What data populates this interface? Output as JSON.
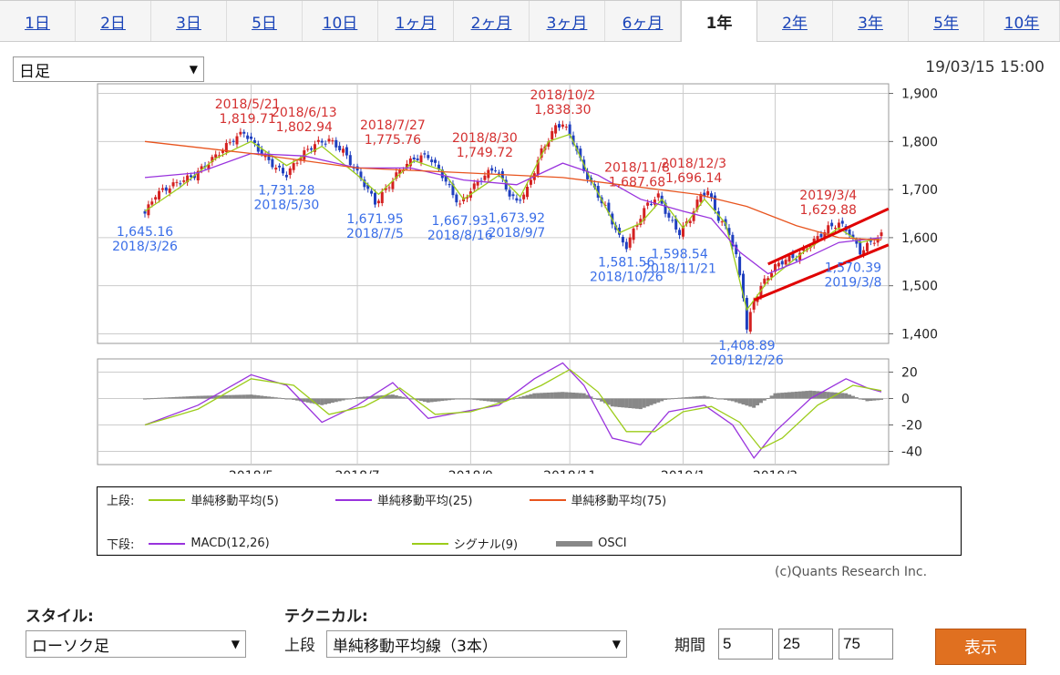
{
  "tabs": [
    "1日",
    "2日",
    "3日",
    "5日",
    "10日",
    "1ヶ月",
    "2ヶ月",
    "3ヶ月",
    "6ヶ月",
    "1年",
    "2年",
    "3年",
    "5年",
    "10年"
  ],
  "active_tab": "1年",
  "period_select": "日足",
  "timestamp": "19/03/15 15:00",
  "colors": {
    "up_candle": "#d42020",
    "down_candle": "#1f3fbf",
    "ma5": "#9ccc1a",
    "ma25": "#9933dd",
    "ma75": "#e8541e",
    "annot_red": "#d43030",
    "annot_blue": "#3a6ee8",
    "osci": "#888888",
    "trendline": "#e00000",
    "button": "#e07020"
  },
  "chart_data": [
    {
      "type": "line",
      "panel": "upper",
      "ylim": [
        1380,
        1920
      ],
      "y_ticks": [
        "1,900",
        "1,800",
        "1,700",
        "1,600",
        "1,500",
        "1,400"
      ],
      "y_tick_values": [
        1900,
        1800,
        1700,
        1600,
        1500,
        1400
      ],
      "x_ticks": [
        "2018/5",
        "2018/7",
        "2018/9",
        "2018/11",
        "2019/1",
        "2019/3"
      ],
      "x_tick_index": [
        30,
        60,
        92,
        120,
        152,
        178
      ],
      "n_days": 184,
      "close_path": [
        [
          0,
          1650
        ],
        [
          3,
          1690
        ],
        [
          8,
          1710
        ],
        [
          14,
          1730
        ],
        [
          20,
          1770
        ],
        [
          25,
          1805
        ],
        [
          28,
          1819
        ],
        [
          33,
          1775
        ],
        [
          37,
          1745
        ],
        [
          40,
          1731
        ],
        [
          44,
          1770
        ],
        [
          48,
          1795
        ],
        [
          52,
          1803
        ],
        [
          56,
          1780
        ],
        [
          59,
          1745
        ],
        [
          63,
          1700
        ],
        [
          65,
          1672
        ],
        [
          68,
          1700
        ],
        [
          72,
          1740
        ],
        [
          76,
          1765
        ],
        [
          80,
          1770
        ],
        [
          84,
          1730
        ],
        [
          87,
          1690
        ],
        [
          89,
          1668
        ],
        [
          92,
          1700
        ],
        [
          96,
          1730
        ],
        [
          99,
          1745
        ],
        [
          103,
          1690
        ],
        [
          105,
          1674
        ],
        [
          108,
          1700
        ],
        [
          112,
          1780
        ],
        [
          116,
          1830
        ],
        [
          118,
          1838
        ],
        [
          121,
          1800
        ],
        [
          124,
          1740
        ],
        [
          127,
          1700
        ],
        [
          131,
          1650
        ],
        [
          134,
          1600
        ],
        [
          136,
          1582
        ],
        [
          139,
          1630
        ],
        [
          142,
          1670
        ],
        [
          145,
          1686
        ],
        [
          148,
          1640
        ],
        [
          151,
          1610
        ],
        [
          154,
          1640
        ],
        [
          157,
          1690
        ],
        [
          159,
          1696
        ],
        [
          162,
          1640
        ],
        [
          165,
          1610
        ],
        [
          167,
          1560
        ],
        [
          169,
          1480
        ],
        [
          170,
          1409
        ],
        [
          172,
          1470
        ],
        [
          175,
          1510
        ],
        [
          178,
          1540
        ],
        [
          181,
          1555
        ],
        [
          184,
          1560
        ],
        [
          187,
          1580
        ],
        [
          190,
          1600
        ],
        [
          193,
          1620
        ],
        [
          196,
          1630
        ],
        [
          199,
          1610
        ],
        [
          202,
          1570
        ],
        [
          205,
          1590
        ],
        [
          208,
          1605
        ]
      ],
      "moving_averages": [
        {
          "name": "単純移動平均(5)",
          "points": [
            [
              0,
              1655
            ],
            [
              10,
              1705
            ],
            [
              20,
              1765
            ],
            [
              30,
              1800
            ],
            [
              40,
              1750
            ],
            [
              50,
              1790
            ],
            [
              60,
              1730
            ],
            [
              66,
              1690
            ],
            [
              76,
              1760
            ],
            [
              84,
              1740
            ],
            [
              90,
              1680
            ],
            [
              100,
              1730
            ],
            [
              106,
              1685
            ],
            [
              114,
              1800
            ],
            [
              120,
              1815
            ],
            [
              126,
              1720
            ],
            [
              134,
              1610
            ],
            [
              140,
              1630
            ],
            [
              146,
              1680
            ],
            [
              152,
              1620
            ],
            [
              158,
              1680
            ],
            [
              164,
              1630
            ],
            [
              170,
              1450
            ],
            [
              176,
              1510
            ],
            [
              186,
              1570
            ],
            [
              196,
              1620
            ],
            [
              202,
              1590
            ],
            [
              208,
              1600
            ]
          ]
        },
        {
          "name": "単純移動平均(25)",
          "points": [
            [
              0,
              1725
            ],
            [
              15,
              1735
            ],
            [
              30,
              1775
            ],
            [
              45,
              1770
            ],
            [
              60,
              1745
            ],
            [
              75,
              1745
            ],
            [
              90,
              1720
            ],
            [
              105,
              1710
            ],
            [
              118,
              1755
            ],
            [
              128,
              1730
            ],
            [
              140,
              1680
            ],
            [
              152,
              1655
            ],
            [
              160,
              1640
            ],
            [
              168,
              1570
            ],
            [
              176,
              1525
            ],
            [
              186,
              1555
            ],
            [
              196,
              1590
            ],
            [
              208,
              1600
            ]
          ]
        },
        {
          "name": "単純移動平均(75)",
          "points": [
            [
              0,
              1800
            ],
            [
              30,
              1775
            ],
            [
              60,
              1745
            ],
            [
              90,
              1735
            ],
            [
              118,
              1725
            ],
            [
              140,
              1705
            ],
            [
              156,
              1690
            ],
            [
              170,
              1665
            ],
            [
              184,
              1625
            ],
            [
              196,
              1600
            ],
            [
              208,
              1595
            ]
          ]
        }
      ],
      "annotations": [
        {
          "date": "2018/5/21",
          "value": "1,819.71",
          "kind": "high"
        },
        {
          "date": "2018/6/13",
          "value": "1,802.94",
          "kind": "high"
        },
        {
          "date": "2018/7/27",
          "value": "1,775.76",
          "kind": "high"
        },
        {
          "date": "2018/8/30",
          "value": "1,749.72",
          "kind": "high"
        },
        {
          "date": "2018/10/2",
          "value": "1,838.30",
          "kind": "high"
        },
        {
          "date": "2018/11/8",
          "value": "1,687.68",
          "kind": "high"
        },
        {
          "date": "2018/12/3",
          "value": "1,696.14",
          "kind": "high"
        },
        {
          "date": "2019/3/4",
          "value": "1,629.88",
          "kind": "high"
        },
        {
          "date": "2018/3/26",
          "value": "1,645.16",
          "kind": "low"
        },
        {
          "date": "2018/5/30",
          "value": "1,731.28",
          "kind": "low"
        },
        {
          "date": "2018/7/5",
          "value": "1,671.95",
          "kind": "low"
        },
        {
          "date": "2018/8/16",
          "value": "1,667.93",
          "kind": "low"
        },
        {
          "date": "2018/9/7",
          "value": "1,673.92",
          "kind": "low"
        },
        {
          "date": "2018/10/26",
          "value": "1,581.56",
          "kind": "low"
        },
        {
          "date": "2018/11/21",
          "value": "1,598.54",
          "kind": "low"
        },
        {
          "date": "2018/12/26",
          "value": "1,408.89",
          "kind": "low"
        },
        {
          "date": "2019/3/8",
          "value": "1,570.39",
          "kind": "low"
        }
      ]
    },
    {
      "type": "line",
      "panel": "lower",
      "ylim": [
        -50,
        30
      ],
      "y_ticks": [
        "20",
        "0",
        "-20",
        "-40"
      ],
      "y_tick_values": [
        20,
        0,
        -20,
        -40
      ],
      "series": [
        {
          "name": "MACD(12,26)",
          "points": [
            [
              0,
              -20
            ],
            [
              15,
              -5
            ],
            [
              30,
              18
            ],
            [
              40,
              10
            ],
            [
              50,
              -18
            ],
            [
              60,
              -5
            ],
            [
              70,
              12
            ],
            [
              80,
              -15
            ],
            [
              90,
              -10
            ],
            [
              100,
              -5
            ],
            [
              110,
              15
            ],
            [
              118,
              27
            ],
            [
              124,
              10
            ],
            [
              132,
              -30
            ],
            [
              140,
              -35
            ],
            [
              148,
              -10
            ],
            [
              158,
              -5
            ],
            [
              166,
              -20
            ],
            [
              172,
              -45
            ],
            [
              178,
              -25
            ],
            [
              188,
              0
            ],
            [
              198,
              15
            ],
            [
              204,
              8
            ],
            [
              208,
              5
            ]
          ]
        },
        {
          "name": "シグナル(9)",
          "points": [
            [
              0,
              -20
            ],
            [
              15,
              -8
            ],
            [
              30,
              15
            ],
            [
              42,
              10
            ],
            [
              52,
              -12
            ],
            [
              62,
              -6
            ],
            [
              72,
              8
            ],
            [
              82,
              -12
            ],
            [
              92,
              -10
            ],
            [
              102,
              -2
            ],
            [
              112,
              10
            ],
            [
              120,
              22
            ],
            [
              128,
              5
            ],
            [
              136,
              -25
            ],
            [
              144,
              -25
            ],
            [
              152,
              -10
            ],
            [
              160,
              -6
            ],
            [
              168,
              -18
            ],
            [
              174,
              -38
            ],
            [
              180,
              -30
            ],
            [
              190,
              -5
            ],
            [
              200,
              10
            ],
            [
              208,
              6
            ]
          ]
        },
        {
          "name": "OSCI",
          "points": [
            [
              0,
              0
            ],
            [
              15,
              2
            ],
            [
              30,
              3
            ],
            [
              40,
              0
            ],
            [
              50,
              -5
            ],
            [
              60,
              1
            ],
            [
              70,
              3
            ],
            [
              80,
              -3
            ],
            [
              90,
              0
            ],
            [
              100,
              -3
            ],
            [
              110,
              4
            ],
            [
              118,
              5
            ],
            [
              124,
              4
            ],
            [
              132,
              -6
            ],
            [
              140,
              -8
            ],
            [
              148,
              0
            ],
            [
              158,
              2
            ],
            [
              166,
              -2
            ],
            [
              172,
              -7
            ],
            [
              178,
              4
            ],
            [
              188,
              6
            ],
            [
              198,
              4
            ],
            [
              204,
              -2
            ],
            [
              208,
              -1
            ]
          ]
        }
      ]
    }
  ],
  "legend": {
    "upper_prefix": "上段:",
    "upper_items": [
      "単純移動平均(5)",
      "単純移動平均(25)",
      "単純移動平均(75)"
    ],
    "lower_prefix": "下段:",
    "lower_items": [
      "MACD(12,26)",
      "シグナル(9)",
      "OSCI"
    ]
  },
  "copyright": "(c)Quants Research Inc.",
  "controls": {
    "style_label": "スタイル:",
    "style_value": "ローソク足",
    "tech_label": "テクニカル:",
    "upper_label": "上段",
    "tech_value": "単純移動平均線（3本）",
    "period_label": "期間",
    "periods": [
      "5",
      "25",
      "75"
    ],
    "show_button": "表示"
  }
}
